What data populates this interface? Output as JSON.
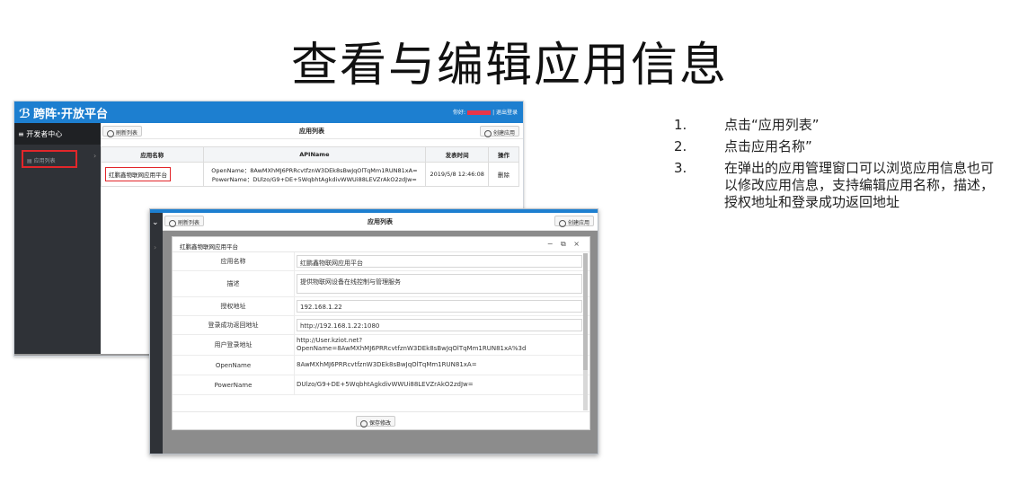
{
  "slide": {
    "title": "查看与编辑应用信息"
  },
  "back": {
    "logo": "跨阵·开放平台",
    "logo_mark": "ℬ",
    "top_right_prefix": "你好:",
    "top_right_logout": "| 退出登录",
    "sidebar": {
      "header": "开发者中心",
      "item": "应用列表"
    },
    "toolbar": {
      "refresh": "刷新列表",
      "title": "应用列表",
      "create": "创建应用"
    },
    "table": {
      "headers": [
        "应用名称",
        "APIName",
        "发表时间",
        "操作"
      ],
      "rows": [
        {
          "name": "红鹏鑫物联网应用平台",
          "api_line1": "OpenName：8AwMXhMJ6PRRcvtfznW3DEk8sBwJqOlTqMm1RUN81xA=",
          "api_line2": "PowerName：DUlzo/G9+DE+5WqbhtAgkdivWWUi88LEVZrAkO2zdJw=",
          "time": "2019/5/8 12:46:08",
          "action": "删除"
        }
      ]
    }
  },
  "front": {
    "toolbar": {
      "refresh": "刷新列表",
      "title": "应用列表",
      "create": "创建应用"
    },
    "modal": {
      "title": "红鹏鑫物联网应用平台",
      "controls": "− ⧉ ×",
      "fields": [
        {
          "label": "应用名称",
          "value": "红鹏鑫物联网应用平台"
        },
        {
          "label": "描述",
          "value": "提供物联网设备在线控制与管理服务"
        },
        {
          "label": "授权地址",
          "value": "192.168.1.22"
        },
        {
          "label": "登录成功返回地址",
          "value": "http://192.168.1.22:1080"
        },
        {
          "label": "用户登录地址",
          "value_line1": "http://User.kziot.net?",
          "value_line2": "OpenName=8AwMXhMJ6PRRcvtfznW3DEk8sBwJqOlTqMm1RUN81xA%3d"
        },
        {
          "label": "OpenName",
          "value": "8AwMXhMJ6PRRcvtfznW3DEk8sBwJqOlTqMm1RUN81xA="
        },
        {
          "label": "PowerName",
          "value": "DUlzo/G9+DE+5WqbhtAgkdivWWUi88LEVZrAkO2zdJw="
        }
      ],
      "save": "保存修改"
    }
  },
  "steps": [
    {
      "num": "1.",
      "text": "点击“应用列表”"
    },
    {
      "num": "2.",
      "text": "点击应用名称”"
    },
    {
      "num": "3.",
      "text": "在弹出的应用管理窗口可以浏览应用信息也可以修改应用信息，支持编辑应用名称，描述，授权地址和登录成功返回地址"
    }
  ],
  "colors": {
    "brand_blue": "#1d7fd0",
    "highlight_red": "#e2262a",
    "sidebar_dark": "#2f3237"
  }
}
